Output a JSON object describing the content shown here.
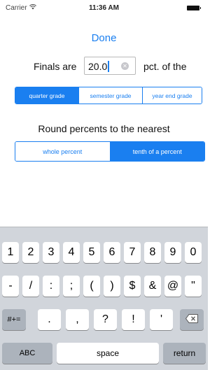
{
  "status_bar": {
    "carrier": "Carrier",
    "wifi_icon": "wifi-icon",
    "time": "11:36 AM",
    "battery_icon": "battery-icon"
  },
  "nav": {
    "done_label": "Done"
  },
  "finals": {
    "prefix": "Finals are",
    "value": "20.0",
    "suffix": "pct. of the",
    "clear_icon": "clear-circle-icon"
  },
  "grade_segment": {
    "options": [
      "quarter grade",
      "semester grade",
      "year end grade"
    ],
    "selected": "quarter grade"
  },
  "round": {
    "label": "Round percents to the nearest",
    "options": [
      "whole percent",
      "tenth of a percent"
    ],
    "selected": "tenth of a percent"
  },
  "keyboard": {
    "row1": [
      "1",
      "2",
      "3",
      "4",
      "5",
      "6",
      "7",
      "8",
      "9",
      "0"
    ],
    "row2": [
      "-",
      "/",
      ":",
      ";",
      "(",
      ")",
      "$",
      "&",
      "@",
      "\""
    ],
    "row3": {
      "symbols_key": "#+=",
      "keys": [
        ".",
        ",",
        "?",
        "!",
        "'"
      ],
      "delete_icon": "backspace-icon"
    },
    "row4": {
      "abc_key": "ABC",
      "space_key": "space",
      "return_key": "return"
    }
  },
  "colors": {
    "accent": "#1a7ff0",
    "keyboard_bg": "#d1d5db",
    "func_key": "#acb3bc"
  }
}
